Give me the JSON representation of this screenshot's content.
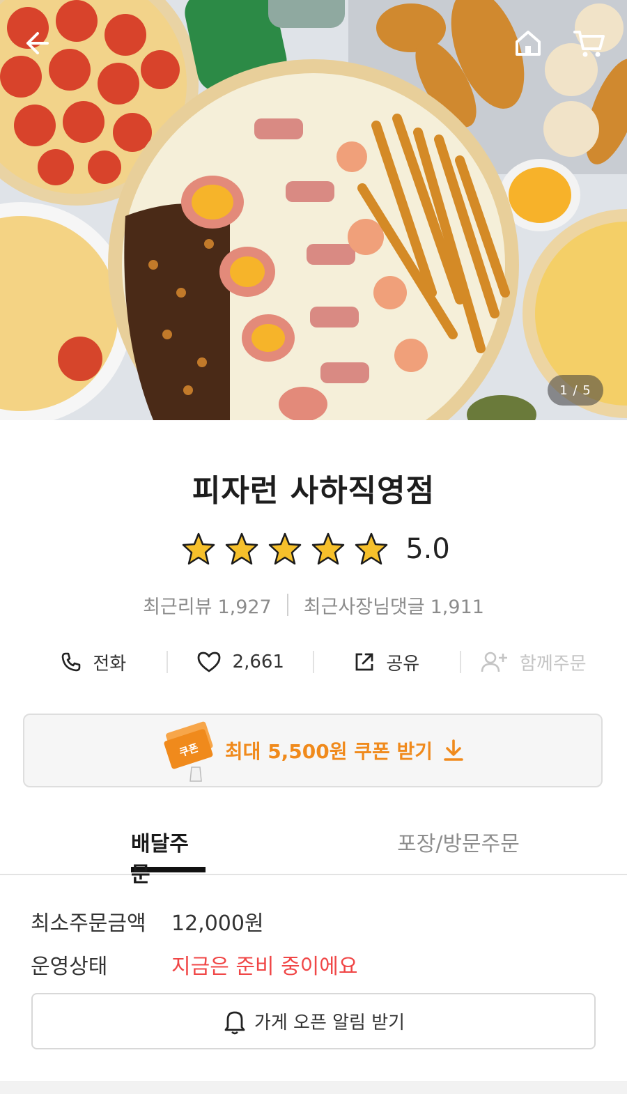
{
  "hero": {
    "image_description": "food-photo",
    "counter": "1 / 5"
  },
  "store": {
    "name": "피자런 사하직영점",
    "rating": "5.0",
    "stars_filled": 5,
    "star_color": "#f6c02b",
    "recent_reviews_label": "최근리뷰",
    "recent_reviews_count": "1,927",
    "owner_replies_label": "최근사장님댓글",
    "owner_replies_count": "1,911"
  },
  "actions": {
    "call": "전화",
    "likes": "2,661",
    "share": "공유",
    "group_order": "함께주문"
  },
  "coupon": {
    "badge": "쿠폰",
    "text": "최대 5,500원 쿠폰 받기",
    "accent": "#f08a1c"
  },
  "tabs": {
    "delivery": "배달주문",
    "pickup": "포장/방문주문"
  },
  "info": {
    "min_order_label": "최소주문금액",
    "min_order_value": "12,000원",
    "status_label": "운영상태",
    "status_value": "지금은 준비 중이에요",
    "status_color": "#f04646"
  },
  "notify_button": "가게 오픈 알림 받기"
}
